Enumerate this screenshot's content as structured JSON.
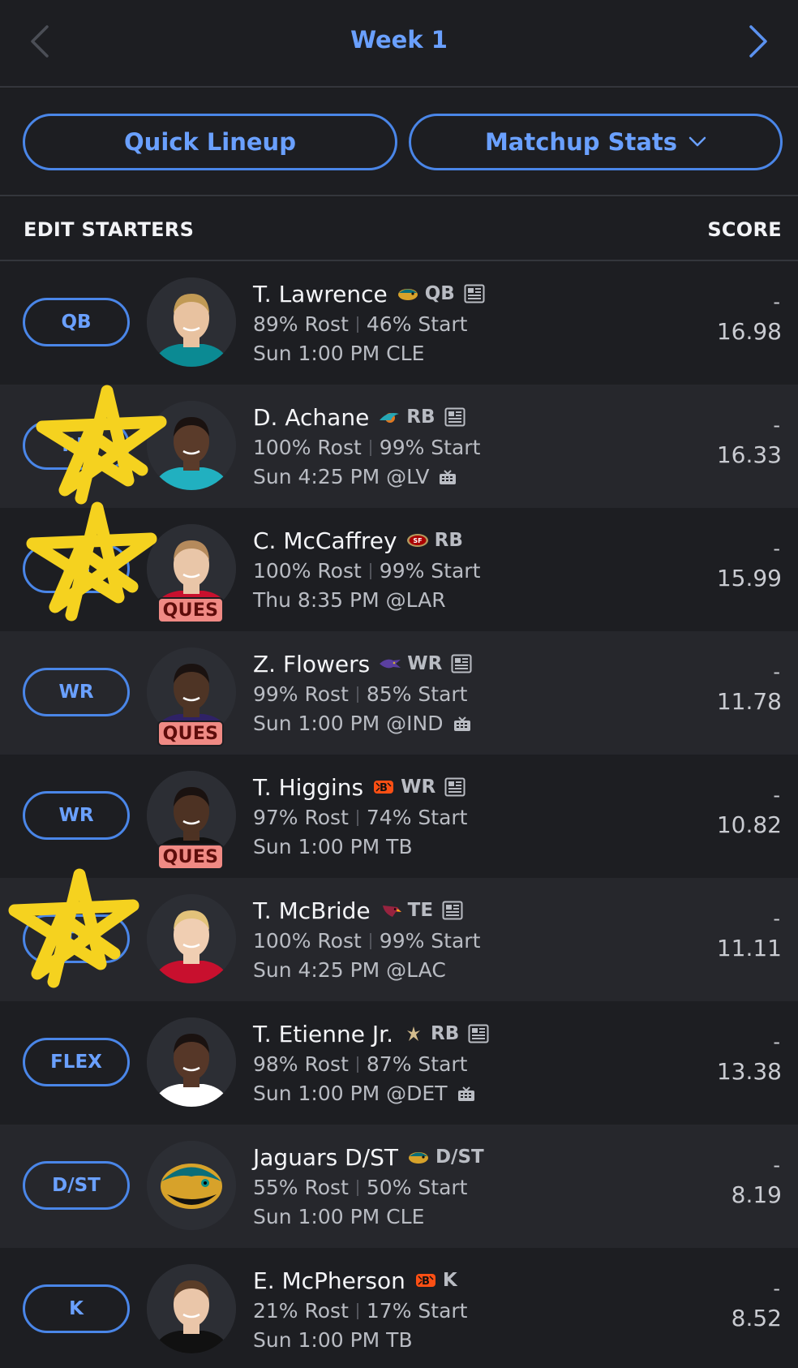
{
  "header": {
    "week_label": "Week 1"
  },
  "buttons": {
    "quick_lineup": "Quick Lineup",
    "matchup_stats": "Matchup Stats"
  },
  "list_header": {
    "left": "EDIT STARTERS",
    "right": "SCORE"
  },
  "colors": {
    "accent": "#4a86e8",
    "ques_badge": "#f08a84",
    "highlighter": "#f5d21f"
  },
  "players": [
    {
      "slot": "QB",
      "name": "T. Lawrence",
      "team_icon": "jaguars-logo",
      "position": "QB",
      "news": true,
      "rost": "89% Rost",
      "start": "46% Start",
      "game": "Sun 1:00 PM CLE",
      "tv": false,
      "status": "",
      "score_dash": "-",
      "score": "16.98",
      "starred": false
    },
    {
      "slot": "RB",
      "name": "D. Achane",
      "team_icon": "dolphins-logo",
      "position": "RB",
      "news": true,
      "rost": "100% Rost",
      "start": "99% Start",
      "game": "Sun 4:25 PM @LV",
      "tv": true,
      "status": "",
      "score_dash": "-",
      "score": "16.33",
      "starred": true
    },
    {
      "slot": "RB",
      "name": "C. McCaffrey",
      "team_icon": "49ers-logo",
      "position": "RB",
      "news": false,
      "rost": "100% Rost",
      "start": "99% Start",
      "game": "Thu 8:35 PM @LAR",
      "tv": false,
      "status": "QUES",
      "score_dash": "-",
      "score": "15.99",
      "starred": true
    },
    {
      "slot": "WR",
      "name": "Z. Flowers",
      "team_icon": "ravens-logo",
      "position": "WR",
      "news": true,
      "rost": "99% Rost",
      "start": "85% Start",
      "game": "Sun 1:00 PM @IND",
      "tv": true,
      "status": "QUES",
      "score_dash": "-",
      "score": "11.78",
      "starred": false
    },
    {
      "slot": "WR",
      "name": "T. Higgins",
      "team_icon": "bengals-logo",
      "position": "WR",
      "news": true,
      "rost": "97% Rost",
      "start": "74% Start",
      "game": "Sun 1:00 PM TB",
      "tv": false,
      "status": "QUES",
      "score_dash": "-",
      "score": "10.82",
      "starred": false
    },
    {
      "slot": "TE",
      "name": "T. McBride",
      "team_icon": "cardinals-logo",
      "position": "TE",
      "news": true,
      "rost": "100% Rost",
      "start": "99% Start",
      "game": "Sun 4:25 PM @LAC",
      "tv": false,
      "status": "",
      "score_dash": "-",
      "score": "11.11",
      "starred": true
    },
    {
      "slot": "FLEX",
      "name": "T. Etienne Jr.",
      "team_icon": "saints-logo",
      "position": "RB",
      "news": true,
      "rost": "98% Rost",
      "start": "87% Start",
      "game": "Sun 1:00 PM @DET",
      "tv": true,
      "status": "",
      "score_dash": "-",
      "score": "13.38",
      "starred": false
    },
    {
      "slot": "D/ST",
      "name": "Jaguars D/ST",
      "team_icon": "jaguars-logo",
      "position": "D/ST",
      "news": false,
      "rost": "55% Rost",
      "start": "50% Start",
      "game": "Sun 1:00 PM CLE",
      "tv": false,
      "status": "",
      "score_dash": "-",
      "score": "8.19",
      "starred": false
    },
    {
      "slot": "K",
      "name": "E. McPherson",
      "team_icon": "bengals-logo",
      "position": "K",
      "news": false,
      "rost": "21% Rost",
      "start": "17% Start",
      "game": "Sun 1:00 PM TB",
      "tv": false,
      "status": "",
      "score_dash": "-",
      "score": "8.52",
      "starred": false
    }
  ]
}
